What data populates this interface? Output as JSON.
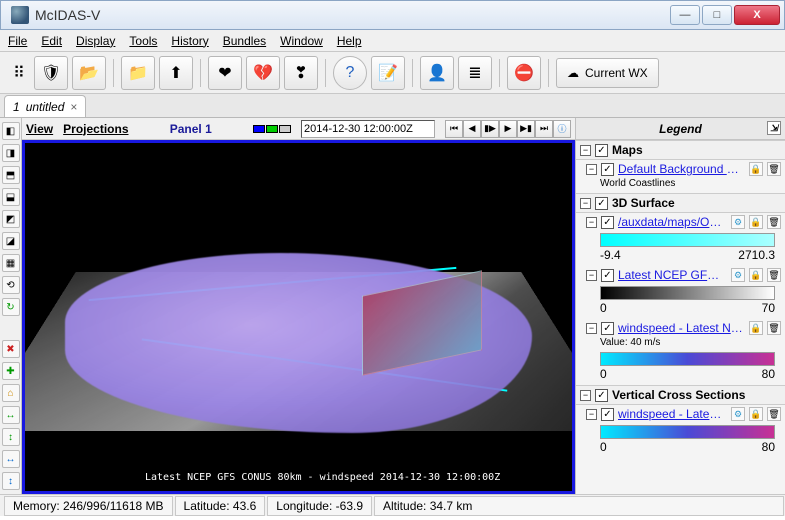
{
  "window": {
    "title": "McIDAS-V",
    "min_glyph": "—",
    "max_glyph": "□",
    "close_glyph": "X"
  },
  "menu": {
    "file": "File",
    "edit": "Edit",
    "display": "Display",
    "tools": "Tools",
    "history": "History",
    "bundles": "Bundles",
    "window": "Window",
    "help": "Help"
  },
  "toolbar": {
    "current_wx_label": "Current WX",
    "current_wx_glyph": "☁"
  },
  "tabs": {
    "active": {
      "label": "untitled",
      "prefix": "1",
      "close": "×"
    }
  },
  "panel": {
    "view_menu": "View",
    "proj_menu": "Projections",
    "label": "Panel 1",
    "time_value": "2014-12-30 12:00:00Z",
    "caption": "Latest NCEP GFS CONUS 80km - windspeed 2014-12-30 12:00:00Z"
  },
  "legend": {
    "title": "Legend",
    "groups": [
      {
        "name": "Maps",
        "layers": [
          {
            "label": "Default Background Ma...",
            "sublabel": "World Coastlines"
          }
        ]
      },
      {
        "name": "3D Surface",
        "layers": [
          {
            "label": "/auxdata/maps/OUT...",
            "bar": "linear-gradient(90deg,#00ffff,#aaffff)",
            "min": "-9.4",
            "max": "2710.3"
          },
          {
            "label": "Latest NCEP GFS C...",
            "bar": "linear-gradient(90deg,#000,#fff)",
            "min": "0",
            "max": "70"
          },
          {
            "label": "windspeed - Latest NC...",
            "subvalue": "Value: 40 m/s",
            "bar": "linear-gradient(90deg,#00eaff,#4a4ad6 50%,#c83094)",
            "min": "0",
            "max": "80"
          }
        ]
      },
      {
        "name": "Vertical Cross Sections",
        "layers": [
          {
            "label": "windspeed - Latest ...",
            "bar": "linear-gradient(90deg,#00eaff,#4a4ad6 50%,#c83094)",
            "min": "0",
            "max": "80"
          }
        ]
      }
    ]
  },
  "status": {
    "memory": "Memory: 246/996/11618 MB",
    "lat": "Latitude:  43.6",
    "lon": "Longitude: -63.9",
    "alt": "Altitude: 34.7 km"
  },
  "glyphs": {
    "shield": "🛡",
    "folder": "📂",
    "open": "📁",
    "upload": "⬆",
    "heart": "❤",
    "heartbreak": "💔",
    "heartplus": "❣",
    "help": "?",
    "note": "📝",
    "user": "👤",
    "list": "≣",
    "stop": "⛔",
    "gear": "⚙",
    "lock": "🔒",
    "trash": "🗑",
    "undock": "⇲",
    "play_first": "⏮",
    "play_prev": "◀",
    "play_pause": "▮▶",
    "play_next": "▶",
    "play_step": "▶▮",
    "play_last": "⏭",
    "play_info": "ⓘ"
  }
}
